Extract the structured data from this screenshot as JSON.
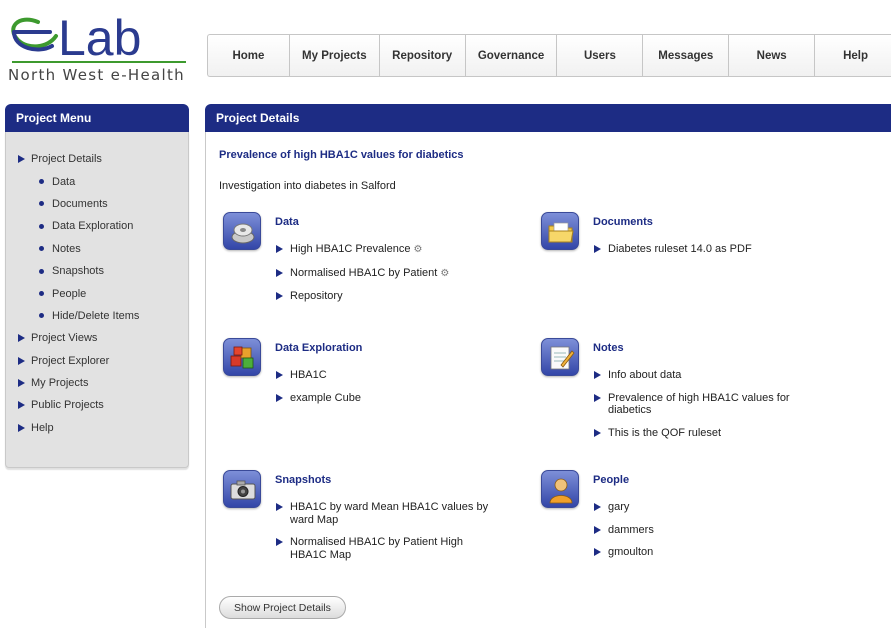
{
  "logo": {
    "text": "Lab",
    "subtitle": "North West e-Health"
  },
  "topnav": [
    "Home",
    "My Projects",
    "Repository",
    "Governance",
    "Users",
    "Messages",
    "News",
    "Help"
  ],
  "sidebar": {
    "title": "Project Menu",
    "items": [
      {
        "label": "Project Details",
        "level": "top"
      },
      {
        "label": "Data",
        "level": "sub"
      },
      {
        "label": "Documents",
        "level": "sub"
      },
      {
        "label": "Data Exploration",
        "level": "sub"
      },
      {
        "label": "Notes",
        "level": "sub"
      },
      {
        "label": "Snapshots",
        "level": "sub"
      },
      {
        "label": "People",
        "level": "sub"
      },
      {
        "label": "Hide/Delete Items",
        "level": "sub"
      },
      {
        "label": "Project Views",
        "level": "top"
      },
      {
        "label": "Project Explorer",
        "level": "top"
      },
      {
        "label": "My Projects",
        "level": "top"
      },
      {
        "label": "Public Projects",
        "level": "top"
      },
      {
        "label": "Help",
        "level": "top"
      }
    ]
  },
  "main": {
    "title": "Project Details",
    "project_title": "Prevalence of high HBA1C values for diabetics",
    "description": "Investigation into diabetes in Salford",
    "sections": {
      "data": {
        "title": "Data",
        "icon": "disk-icon",
        "items": [
          {
            "label": "High HBA1C Prevalence",
            "gear": true
          },
          {
            "label": "Normalised HBA1C by Patient",
            "gear": true
          },
          {
            "label": "Repository",
            "gear": false
          }
        ]
      },
      "documents": {
        "title": "Documents",
        "icon": "folder-icon",
        "items": [
          {
            "label": "Diabetes ruleset 14.0 as PDF"
          }
        ]
      },
      "exploration": {
        "title": "Data Exploration",
        "icon": "cubes-icon",
        "items": [
          {
            "label": "HBA1C"
          },
          {
            "label": "example Cube"
          }
        ]
      },
      "notes": {
        "title": "Notes",
        "icon": "notepad-icon",
        "items": [
          {
            "label": "Info about data"
          },
          {
            "label": "Prevalence of high HBA1C values for diabetics"
          },
          {
            "label": "This is the QOF ruleset"
          }
        ]
      },
      "snapshots": {
        "title": "Snapshots",
        "icon": "camera-icon",
        "items": [
          {
            "label": "HBA1C by ward Mean HBA1C values by ward Map"
          },
          {
            "label": "Normalised HBA1C by Patient High HBA1C Map"
          }
        ]
      },
      "people": {
        "title": "People",
        "icon": "person-icon",
        "items": [
          {
            "label": "gary"
          },
          {
            "label": "dammers"
          },
          {
            "label": "gmoulton"
          }
        ]
      }
    },
    "gear_glyph": "⚙",
    "show_button": "Show Project Details"
  },
  "colors": {
    "accent": "#1d2c84",
    "logo_green": "#3d9a2e",
    "logo_blue": "#2b3b8f"
  }
}
